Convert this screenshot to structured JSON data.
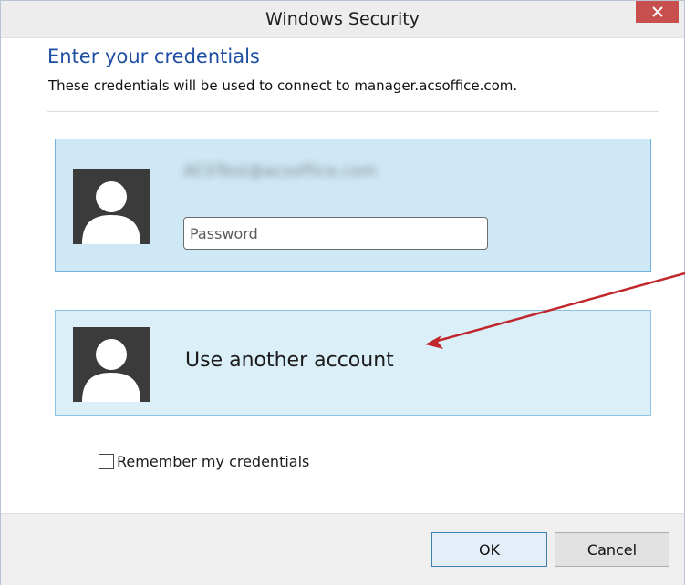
{
  "window": {
    "title": "Windows Security",
    "close_icon": "close-icon"
  },
  "dialog": {
    "heading": "Enter your credentials",
    "description": "These credentials will be used to connect to manager.acsoffice.com."
  },
  "accounts": [
    {
      "username": "ACSTest@acsoffice.com",
      "username_blurred": true,
      "avatar_icon": "user-avatar-icon",
      "password_placeholder": "Password",
      "password_value": ""
    },
    {
      "label": "Use another account",
      "avatar_icon": "user-avatar-icon"
    }
  ],
  "remember": {
    "label": "Remember my credentials",
    "checked": false
  },
  "buttons": {
    "ok": "OK",
    "cancel": "Cancel"
  },
  "annotation": {
    "arrow_icon": "red-arrow-icon",
    "color": "#c0262b"
  },
  "colors": {
    "heading": "#1f4fa3",
    "tile_selected": "#cfe8f5",
    "tile_hover": "#dbeff9",
    "close_button": "#c7504f"
  }
}
